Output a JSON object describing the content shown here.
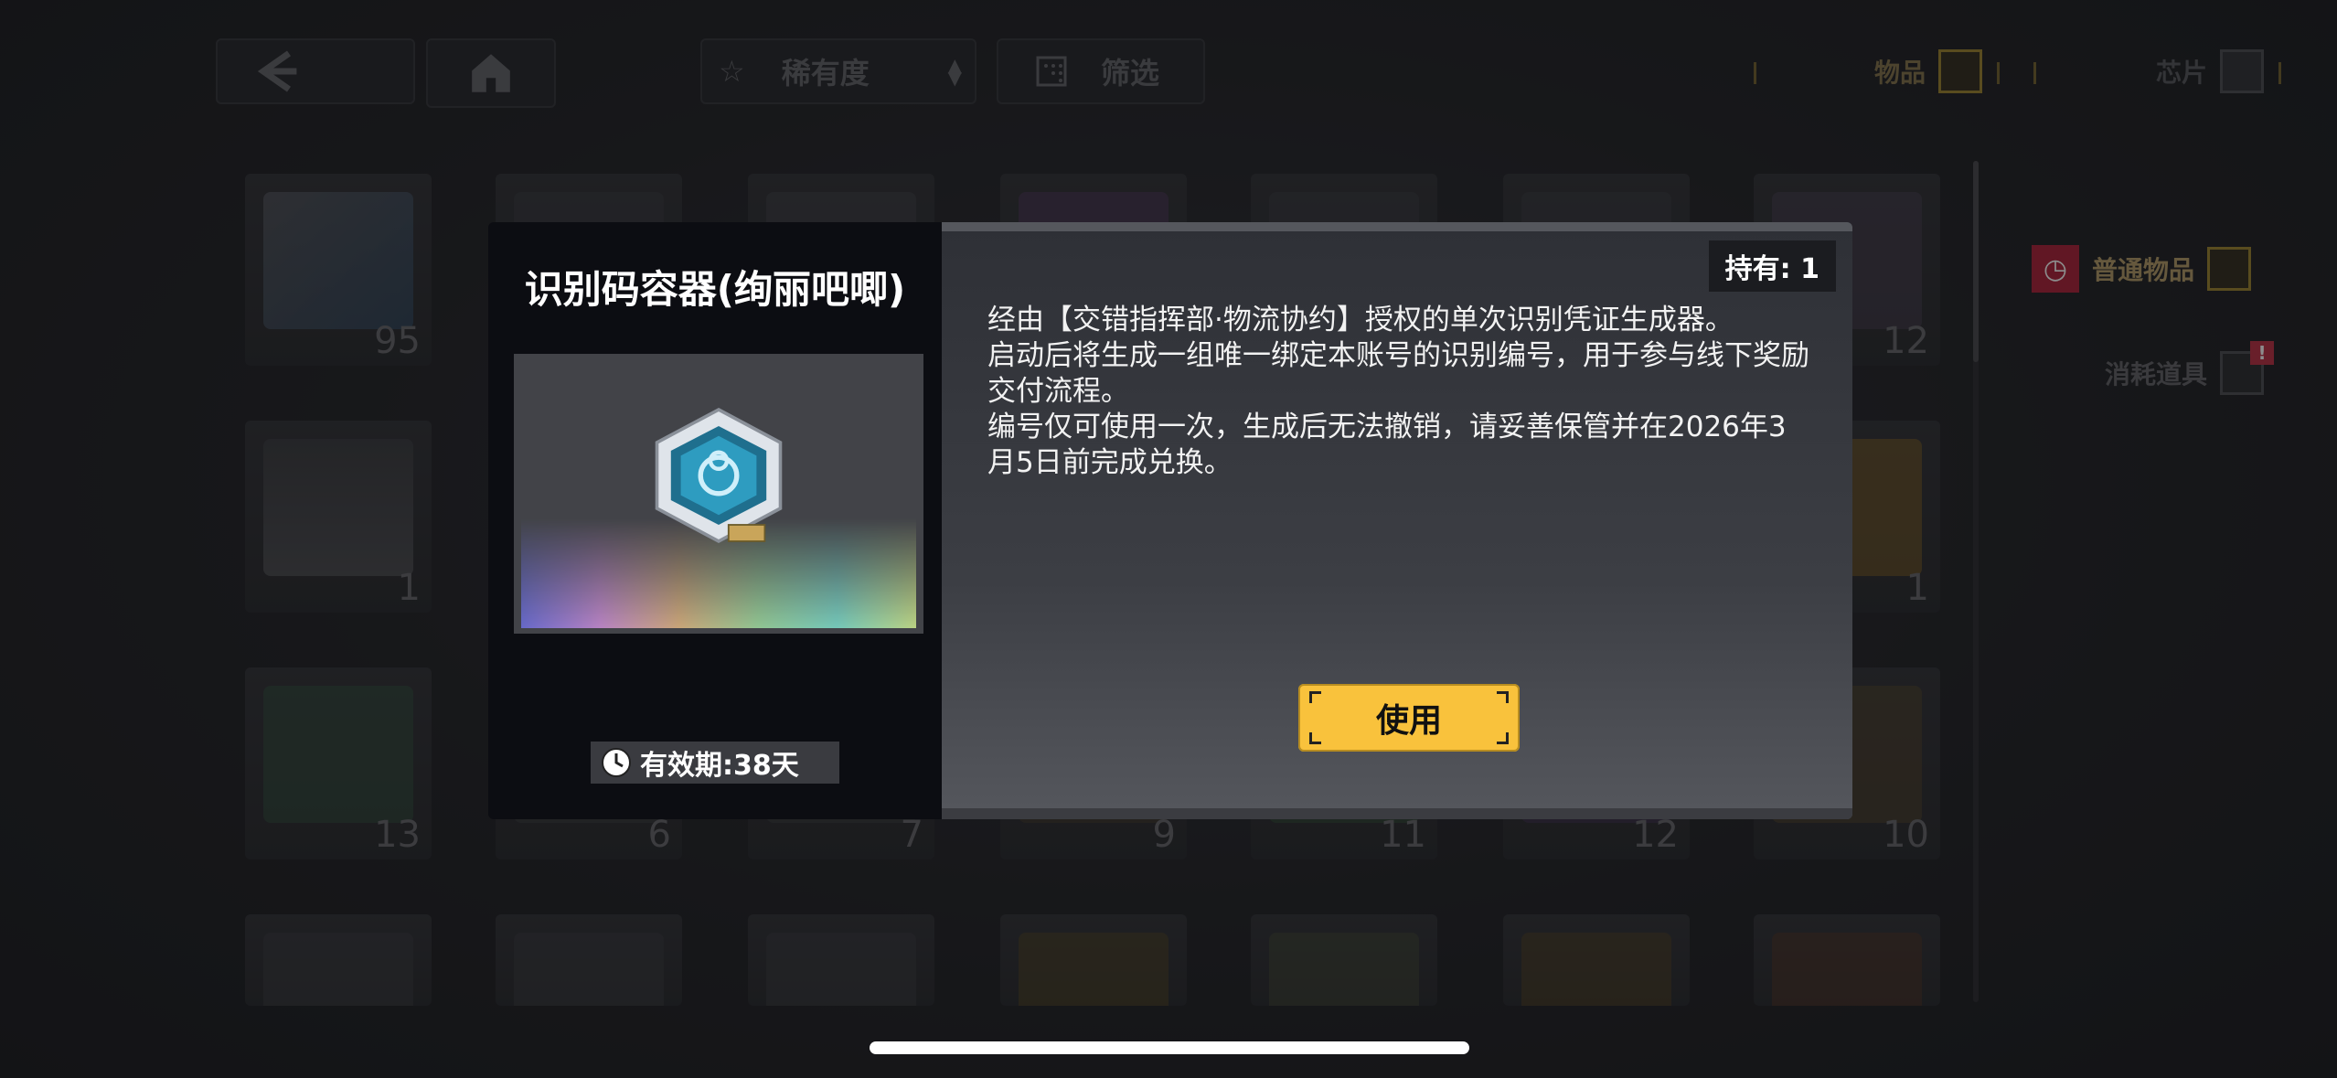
{
  "toolbar": {
    "back_icon": "chevron-left-icon",
    "home_icon": "home-icon",
    "sort_label": "稀有度",
    "filter_label": "筛选"
  },
  "tabs": {
    "items_label": "物品",
    "chips_label": "芯片"
  },
  "categories": {
    "normal_label": "普通物品",
    "consumable_label": "消耗道具",
    "consumable_badge": "!"
  },
  "grid": {
    "counts_row1": [
      "95",
      "",
      "",
      "",
      "",
      "",
      "12"
    ],
    "counts_row2": [
      "1",
      "",
      "",
      "",
      "",
      "",
      "1"
    ],
    "counts_row3": [
      "13",
      "6",
      "7",
      "9",
      "11",
      "12",
      "10"
    ]
  },
  "modal": {
    "title": "识别码容器(绚丽吧唧)",
    "holding": "持有: 1",
    "description": [
      "经由【交错指挥部·物流协约】授权的单次识别凭证生成器。",
      "启动后将生成一组唯一绑定本账号的识别编号，用于参与线下奖励交付流程。",
      "编号仅可使用一次，生成后无法撤销，请妥善保管并在2026年3月5日前完成兑换。"
    ],
    "validity": "有效期:38天",
    "use_label": "使用"
  },
  "colors": {
    "accent_gold": "#f9c23c",
    "badge_red": "#e03a4f"
  }
}
